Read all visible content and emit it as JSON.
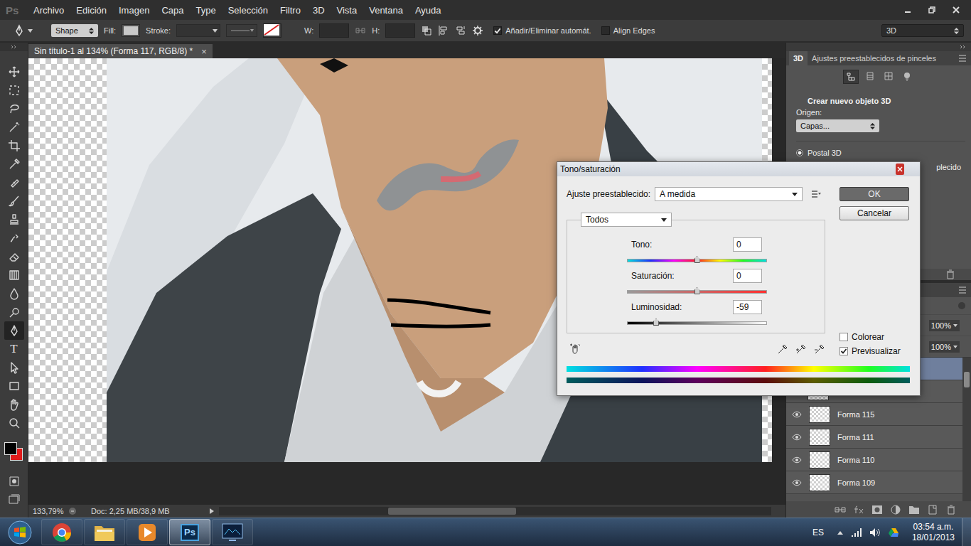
{
  "menu_bar": {
    "logo": "Ps",
    "items": [
      "Archivo",
      "Edición",
      "Imagen",
      "Capa",
      "Type",
      "Selección",
      "Filtro",
      "3D",
      "Vista",
      "Ventana",
      "Ayuda"
    ]
  },
  "options_bar": {
    "mode": "Shape",
    "fill_label": "Fill:",
    "stroke_label": "Stroke:",
    "w_label": "W:",
    "h_label": "H:",
    "checkboxes": [
      {
        "label": "Añadir/Eliminar automát.",
        "checked": true
      },
      {
        "label": "Align Edges",
        "checked": false
      }
    ],
    "workspace": "3D"
  },
  "document_tab": {
    "title": "Sin título-1 al 134% (Forma 117, RGB/8) *",
    "close": "×"
  },
  "tools": [
    {
      "kind": "move",
      "selected": false
    },
    {
      "kind": "marquee",
      "selected": false
    },
    {
      "kind": "lasso",
      "selected": false
    },
    {
      "kind": "wand",
      "selected": false
    },
    {
      "kind": "crop",
      "selected": false
    },
    {
      "kind": "eyedropper",
      "selected": false
    },
    {
      "kind": "heal",
      "selected": false
    },
    {
      "kind": "brush",
      "selected": false
    },
    {
      "kind": "stamp",
      "selected": false
    },
    {
      "kind": "history",
      "selected": false
    },
    {
      "kind": "eraser",
      "selected": false
    },
    {
      "kind": "gradient",
      "selected": false
    },
    {
      "kind": "blur",
      "selected": false
    },
    {
      "kind": "dodge",
      "selected": false
    },
    {
      "kind": "pen",
      "selected": true
    },
    {
      "kind": "type",
      "label": "T",
      "selected": false
    },
    {
      "kind": "path-select",
      "selected": false
    },
    {
      "kind": "shape",
      "selected": false
    },
    {
      "kind": "hand",
      "selected": false
    },
    {
      "kind": "zoom",
      "selected": false
    }
  ],
  "swatches": {
    "foreground": "#000000",
    "background": "#e01c1c"
  },
  "status_bar": {
    "zoom": "133,79%",
    "doc": "Doc: 2,25 MB/38,9 MB"
  },
  "panel_3d": {
    "tabs": [
      {
        "label": "3D",
        "selected": true
      },
      {
        "label": "Ajustes preestablecidos de pinceles",
        "selected": false
      }
    ],
    "heading": "Crear nuevo objeto 3D",
    "origin_label": "Origen:",
    "origin_value": "Capas...",
    "options": [
      {
        "label": "Postal 3D",
        "selected": true
      }
    ],
    "covered_text": "plecido"
  },
  "layers": {
    "opacity": "100%",
    "fill": "100%",
    "covered_rows": [
      {
        "selected": true
      },
      {
        "selected": false
      }
    ],
    "rows": [
      {
        "name": "Forma 115",
        "visible": true
      },
      {
        "name": "Forma 111",
        "visible": true
      },
      {
        "name": "Forma 110",
        "visible": true
      },
      {
        "name": "Forma 109",
        "visible": true
      }
    ]
  },
  "dialog": {
    "title": "Tono/saturación",
    "preset_label": "Ajuste preestablecido:",
    "preset": "A medida",
    "channel": "Todos",
    "sliders": [
      {
        "kind": "hue",
        "label": "Tono:",
        "value": "0",
        "level": 0.5
      },
      {
        "kind": "saturation",
        "label": "Saturación:",
        "value": "0",
        "level": 0.5
      },
      {
        "kind": "lightness",
        "label": "Luminosidad:",
        "value": "-59",
        "level": 0.205
      }
    ],
    "buttons": [
      {
        "label": "OK",
        "default": true
      },
      {
        "label": "Cancelar",
        "default": false
      }
    ],
    "checkboxes": [
      {
        "label": "Colorear",
        "checked": false
      },
      {
        "label": "Previsualizar",
        "checked": true
      }
    ]
  },
  "taskbar": {
    "apps": [
      {
        "kind": "chrome",
        "active": false
      },
      {
        "kind": "explorer",
        "active": false
      },
      {
        "kind": "media",
        "active": false
      },
      {
        "kind": "photoshop",
        "label": "Ps",
        "active": true
      },
      {
        "kind": "app",
        "active": false
      }
    ],
    "language": "ES",
    "time": "03:54 a.m.",
    "date": "18/01/2013"
  }
}
